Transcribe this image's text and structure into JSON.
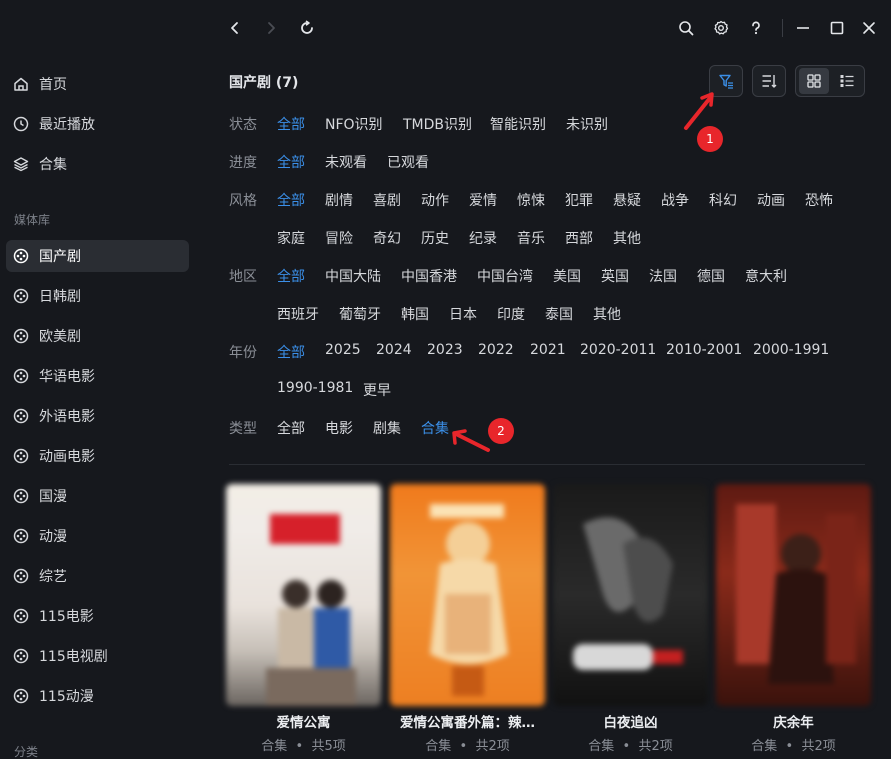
{
  "sidebar": {
    "items": [
      {
        "label": "首页",
        "icon": "home-icon"
      },
      {
        "label": "最近播放",
        "icon": "clock-icon"
      },
      {
        "label": "合集",
        "icon": "layers-icon"
      }
    ],
    "media_section_title": "媒体库",
    "libraries": [
      {
        "label": "国产剧",
        "active": true
      },
      {
        "label": "日韩剧"
      },
      {
        "label": "欧美剧"
      },
      {
        "label": "华语电影"
      },
      {
        "label": "外语电影"
      },
      {
        "label": "动画电影"
      },
      {
        "label": "国漫"
      },
      {
        "label": "动漫"
      },
      {
        "label": "综艺"
      },
      {
        "label": "115电影"
      },
      {
        "label": "115电视剧"
      },
      {
        "label": "115动漫"
      }
    ],
    "category_section_title": "分类"
  },
  "header": {
    "title": "国产剧 (7)"
  },
  "filters": {
    "status": {
      "label": "状态",
      "options": [
        "全部",
        "NFO识别",
        "TMDB识别",
        "智能识别",
        "未识别"
      ],
      "selected": "全部"
    },
    "progress": {
      "label": "进度",
      "options": [
        "全部",
        "未观看",
        "已观看"
      ],
      "selected": "全部"
    },
    "genre": {
      "label": "风格",
      "options": [
        "全部",
        "剧情",
        "喜剧",
        "动作",
        "爱情",
        "惊悚",
        "犯罪",
        "悬疑",
        "战争",
        "科幻",
        "动画",
        "恐怖",
        "家庭",
        "冒险",
        "奇幻",
        "历史",
        "纪录",
        "音乐",
        "西部",
        "其他"
      ],
      "selected": "全部"
    },
    "region": {
      "label": "地区",
      "options": [
        "全部",
        "中国大陆",
        "中国香港",
        "中国台湾",
        "美国",
        "英国",
        "法国",
        "德国",
        "意大利",
        "西班牙",
        "葡萄牙",
        "韩国",
        "日本",
        "印度",
        "泰国",
        "其他"
      ],
      "selected": "全部"
    },
    "year": {
      "label": "年份",
      "options": [
        "全部",
        "2025",
        "2024",
        "2023",
        "2022",
        "2021",
        "2020-2011",
        "2010-2001",
        "2000-1991",
        "1990-1981",
        "更早"
      ],
      "selected": "全部"
    },
    "type": {
      "label": "类型",
      "options": [
        "全部",
        "电影",
        "剧集",
        "合集"
      ],
      "selected": "合集"
    }
  },
  "annotations": {
    "badge1": "1",
    "badge2": "2"
  },
  "cards": [
    {
      "title": "爱情公寓",
      "type": "合集",
      "sep": "•",
      "count": "共5项"
    },
    {
      "title": "爱情公寓番外篇：辣…",
      "type": "合集",
      "sep": "•",
      "count": "共2项"
    },
    {
      "title": "白夜追凶",
      "type": "合集",
      "sep": "•",
      "count": "共2项"
    },
    {
      "title": "庆余年",
      "type": "合集",
      "sep": "•",
      "count": "共2项"
    }
  ],
  "colors": {
    "accent": "#3b8fe8",
    "annotation": "#e8262b",
    "background": "#16181d"
  }
}
